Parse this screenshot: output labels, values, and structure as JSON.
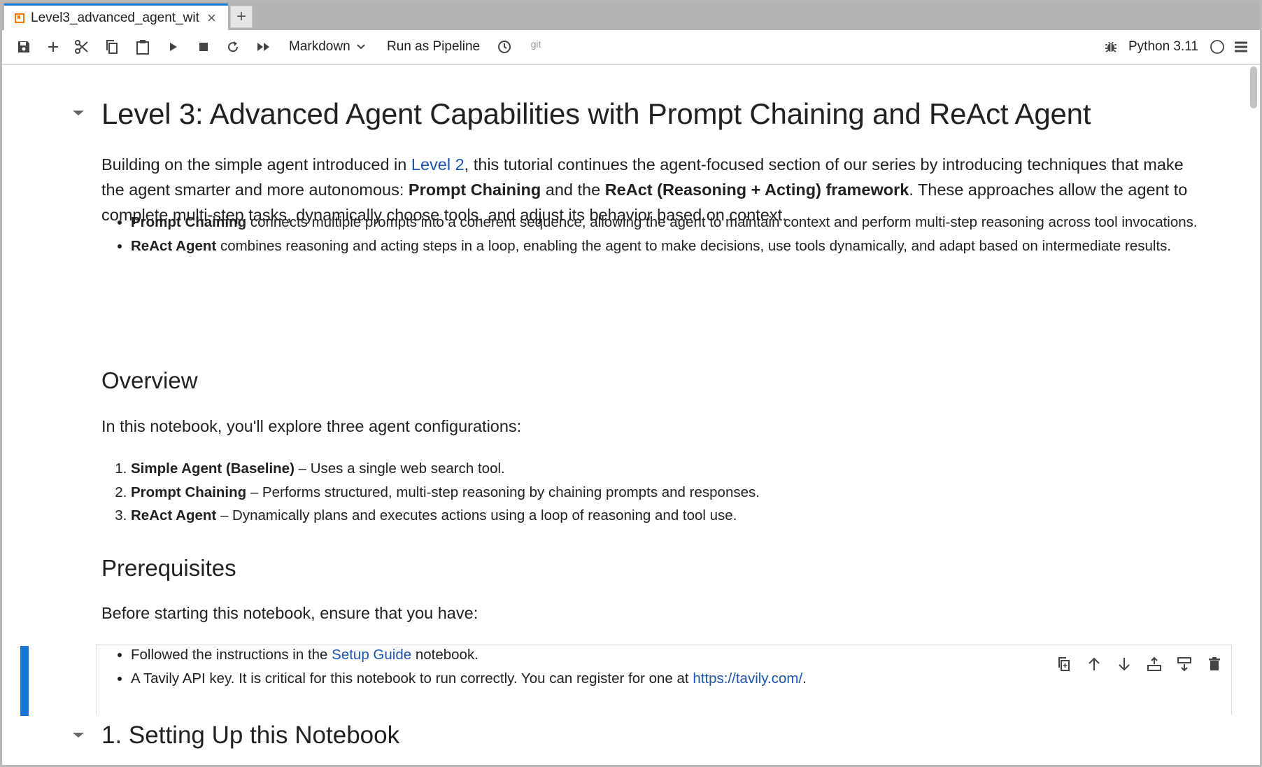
{
  "tab": {
    "title": "Level3_advanced_agent_wit",
    "close_glyph": "×",
    "new_tab_glyph": "+"
  },
  "toolbar": {
    "cell_type": "Markdown",
    "pipeline": "Run as Pipeline",
    "git": "git",
    "kernel": "Python 3.11",
    "icons": [
      "save-icon",
      "add-cell-icon",
      "cut-icon",
      "copy-icon",
      "paste-icon",
      "run-icon",
      "stop-icon",
      "restart-icon",
      "fast-forward-icon",
      "chevron-down-icon",
      "clock-icon",
      "bug-icon",
      "kernel-status-icon",
      "menu-icon"
    ]
  },
  "notebook": {
    "title": "Level 3: Advanced Agent Capabilities with Prompt Chaining and ReAct Agent",
    "intro": {
      "t1": "Building on the simple agent introduced in ",
      "link": "Level 2",
      "t2": ", this tutorial continues the agent-focused section of our series by introducing techniques that make the agent smarter and more autonomous: ",
      "b1": "Prompt Chaining",
      "t3": " and the ",
      "b2": "ReAct (Reasoning + Acting) framework",
      "t4": ". These approaches allow the agent to complete multi-step tasks, dynamically choose tools, and adjust its behavior based on context."
    },
    "bullets": [
      {
        "bold": "Prompt Chaining",
        "text": " connects multiple prompts into a coherent sequence, allowing the agent to maintain context and perform multi-step reasoning across tool invocations."
      },
      {
        "bold": "ReAct Agent",
        "text": " combines reasoning and acting steps in a loop, enabling the agent to make decisions, use tools dynamically, and adapt based on intermediate results."
      }
    ],
    "overview": {
      "heading": "Overview",
      "intro": "In this notebook, you'll explore three agent configurations:",
      "items": [
        {
          "bold": "Simple Agent (Baseline)",
          "text": " – Uses a single web search tool."
        },
        {
          "bold": "Prompt Chaining",
          "text": " – Performs structured, multi-step reasoning by chaining prompts and responses."
        },
        {
          "bold": "ReAct Agent",
          "text": " – Dynamically plans and executes actions using a loop of reasoning and tool use."
        }
      ]
    },
    "prereq": {
      "heading": "Prerequisites",
      "intro": "Before starting this notebook, ensure that you have:",
      "item1": {
        "t1": "Followed the instructions in the ",
        "link": "Setup Guide",
        "t2": " notebook."
      },
      "item2": {
        "t1": "A Tavily API key. It is critical for this notebook to run correctly. You can register for one at ",
        "link": "https://tavily.com/",
        "t2": "."
      }
    },
    "section1": "1. Setting Up this Notebook"
  },
  "cell_toolbar_icons": [
    "duplicate-cell-icon",
    "move-up-icon",
    "move-down-icon",
    "insert-above-icon",
    "insert-below-icon",
    "delete-cell-icon"
  ],
  "colors": {
    "accent": "#1976d2",
    "link": "#1a55b0",
    "tab_strip": "#b4b4b4"
  }
}
